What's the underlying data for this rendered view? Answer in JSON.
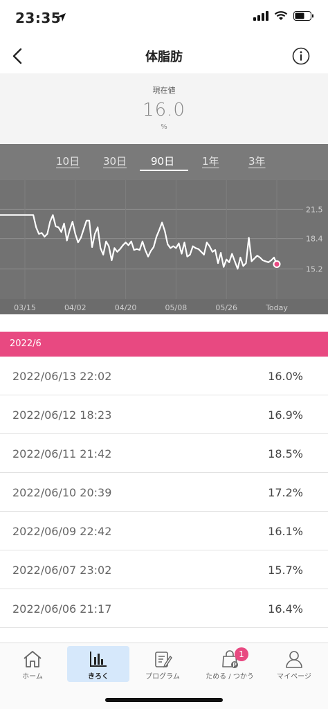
{
  "status": {
    "time": "23:35"
  },
  "nav": {
    "title": "体脂肪"
  },
  "current": {
    "label": "現在値",
    "value": "16.0",
    "unit": "%"
  },
  "tabs": [
    {
      "label": "10日",
      "active": false
    },
    {
      "label": "30日",
      "active": false
    },
    {
      "label": "90日",
      "active": true
    },
    {
      "label": "1年",
      "active": false
    },
    {
      "label": "3年",
      "active": false
    }
  ],
  "chart_data": {
    "type": "line",
    "ylim": [
      12.0,
      24.6
    ],
    "y_ticks": [
      "21.5",
      "18.4",
      "15.2"
    ],
    "y_tick_values": [
      21.5,
      18.4,
      15.2
    ],
    "x_ticks": [
      "03/15",
      "04/02",
      "04/20",
      "05/08",
      "05/26",
      "Today"
    ],
    "x_tick_days": [
      0,
      18,
      36,
      54,
      72,
      90
    ],
    "grid": true,
    "point_color": "#e84981",
    "series": [
      {
        "days": [
          -3,
          3,
          4,
          5,
          6,
          7,
          8,
          9,
          10,
          11,
          12,
          13,
          14,
          15,
          16,
          17,
          18,
          19,
          20,
          21,
          22,
          23,
          24,
          25,
          26,
          27,
          28,
          29,
          30,
          31,
          32,
          33,
          34,
          35,
          36,
          37,
          38,
          39,
          40,
          41,
          42,
          43,
          44,
          45,
          46,
          47,
          48,
          49,
          50,
          51,
          52,
          53,
          54,
          55,
          56,
          57,
          58,
          59,
          60,
          61,
          62,
          63,
          64,
          65,
          66,
          67,
          68,
          69,
          70,
          71,
          72,
          73,
          74,
          75,
          76,
          77,
          78,
          79,
          80,
          81,
          82,
          83,
          84,
          85,
          86,
          87,
          88,
          89,
          90
        ],
        "values": [
          20.9,
          20.9,
          19.6,
          18.9,
          19.0,
          18.6,
          18.9,
          20.2,
          20.9,
          19.7,
          19.6,
          19.1,
          20.0,
          18.2,
          19.3,
          20.2,
          18.9,
          18.0,
          18.5,
          19.4,
          20.3,
          20.3,
          17.5,
          18.9,
          19.6,
          17.4,
          16.7,
          18.1,
          17.6,
          16.1,
          17.4,
          17.0,
          17.3,
          17.7,
          18.0,
          17.7,
          18.1,
          17.2,
          17.3,
          17.2,
          18.1,
          17.2,
          16.5,
          17.1,
          17.5,
          18.6,
          19.3,
          20.1,
          19.2,
          17.8,
          17.4,
          17.6,
          17.4,
          17.9,
          16.8,
          18.0,
          16.5,
          16.7,
          17.6,
          17.4,
          17.3,
          17.0,
          16.7,
          18.0,
          17.6,
          17.0,
          17.2,
          15.8,
          16.9,
          15.4,
          16.2,
          15.9,
          16.8,
          16.0,
          15.2,
          16.4,
          15.5,
          15.8,
          18.5,
          16.0,
          16.3,
          16.6,
          16.4,
          16.1,
          16.0,
          15.9,
          16.1,
          16.4,
          15.7
        ]
      }
    ]
  },
  "month": {
    "label": "2022/6"
  },
  "records": [
    {
      "date": "2022/06/13 22:02",
      "value": "16.0%"
    },
    {
      "date": "2022/06/12 18:23",
      "value": "16.9%"
    },
    {
      "date": "2022/06/11 21:42",
      "value": "18.5%"
    },
    {
      "date": "2022/06/10 20:39",
      "value": "17.2%"
    },
    {
      "date": "2022/06/09 22:42",
      "value": "16.1%"
    },
    {
      "date": "2022/06/07 23:02",
      "value": "15.7%"
    },
    {
      "date": "2022/06/06 21:17",
      "value": "16.4%"
    }
  ],
  "tabbar": {
    "items": [
      {
        "label": "ホーム",
        "icon": "home-icon",
        "active": false
      },
      {
        "label": "きろく",
        "icon": "chart-icon",
        "active": true
      },
      {
        "label": "プログラム",
        "icon": "program-icon",
        "active": false
      },
      {
        "label": "ためる / つかう",
        "icon": "bag-points-icon",
        "active": false,
        "badge": "1"
      },
      {
        "label": "マイページ",
        "icon": "person-icon",
        "active": false
      }
    ]
  }
}
